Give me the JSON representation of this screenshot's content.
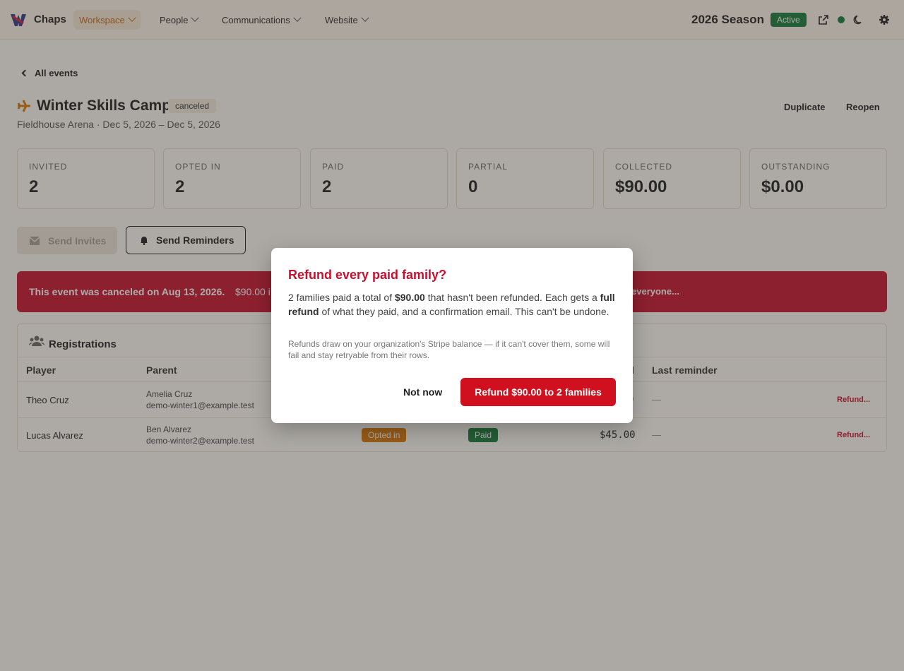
{
  "nav": {
    "brand": "Chaps",
    "items": [
      {
        "label": "Workspace",
        "active": true
      },
      {
        "label": "People"
      },
      {
        "label": "Communications"
      },
      {
        "label": "Website"
      }
    ],
    "season": "2026 Season",
    "season_status": "Active"
  },
  "page": {
    "back_label": "All events",
    "title": "Winter Skills Camp",
    "status": "canceled",
    "subtitle": "Fieldhouse Arena · Dec 5, 2026 – Dec 5, 2026",
    "actions": {
      "duplicate": "Duplicate",
      "reopen": "Reopen"
    }
  },
  "stats": [
    {
      "label": "INVITED",
      "value": "2"
    },
    {
      "label": "OPTED IN",
      "value": "2"
    },
    {
      "label": "PAID",
      "value": "2"
    },
    {
      "label": "PARTIAL",
      "value": "0"
    },
    {
      "label": "COLLECTED",
      "value": "$90.00"
    },
    {
      "label": "OUTSTANDING",
      "value": "$0.00"
    }
  ],
  "buttons": {
    "send_invites": "Send Invites",
    "send_reminders": "Send Reminders"
  },
  "banner": {
    "bold": "This event was canceled on Aug 13, 2026.",
    "text": "$90.00 i",
    "action": "everyone..."
  },
  "registrations": {
    "title": "Registrations",
    "columns": {
      "player": "Player",
      "parent": "Parent",
      "amount": "l",
      "last_reminder": "Last reminder"
    },
    "rows": [
      {
        "player": "Theo Cruz",
        "parent_name": "Amelia Cruz",
        "parent_email": "demo-winter1@example.test",
        "amount": "0",
        "last_reminder": "—",
        "action": "Refund..."
      },
      {
        "player": "Lucas Alvarez",
        "parent_name": "Ben Alvarez",
        "parent_email": "demo-winter2@example.test",
        "opt": "Opted in",
        "pay": "Paid",
        "amount": "$45.00",
        "last_reminder": "—",
        "action": "Refund..."
      }
    ]
  },
  "modal": {
    "title": "Refund every paid family?",
    "body_1": "2 families paid a total of ",
    "body_amount": "$90.00",
    "body_2": " that hasn't been refunded. Each gets a ",
    "body_bold": "full refund",
    "body_3": " of what they paid, and a confirmation email. This can't be undone.",
    "note": "Refunds draw on your organization's Stripe balance — if it can't cover them, some will fail and stay retryable from their rows.",
    "cancel": "Not now",
    "confirm": "Refund $90.00 to 2 families"
  },
  "colors": {
    "accent": "#c96a14",
    "danger": "#c8102e",
    "success": "#127a3a",
    "warning": "#d97706"
  }
}
